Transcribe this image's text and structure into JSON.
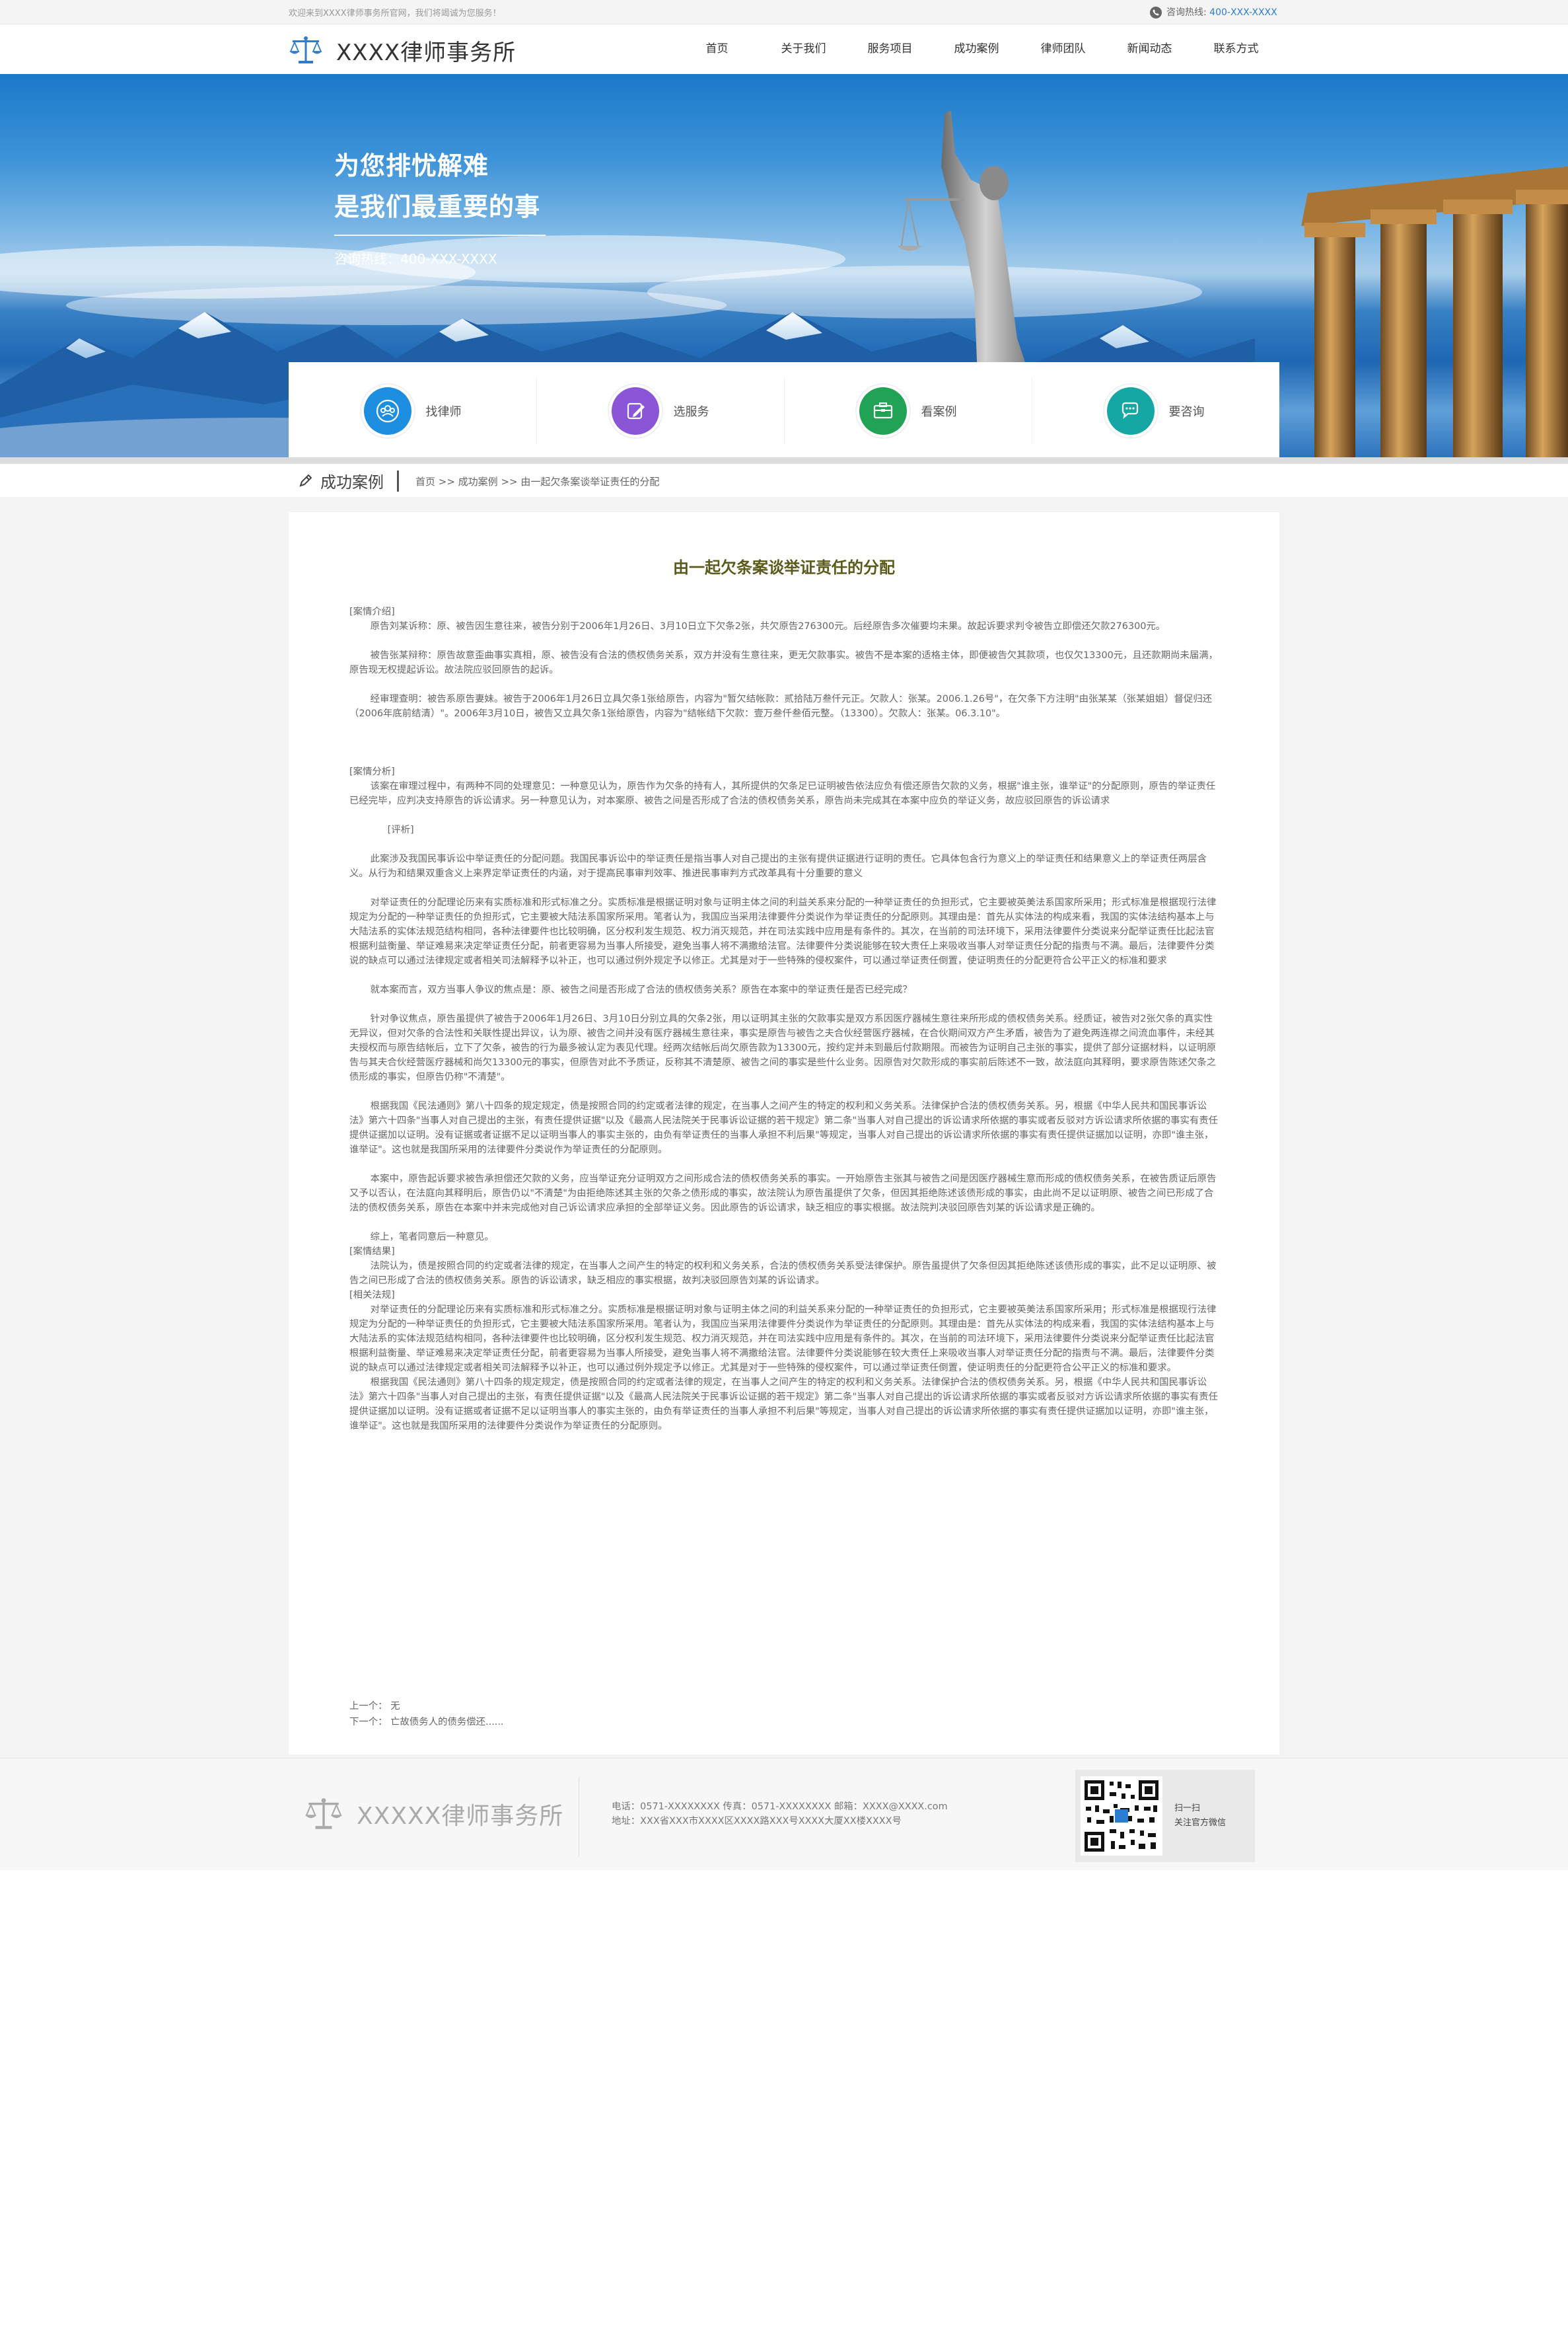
{
  "topbar": {
    "welcome": "欢迎来到XXXX律师事务所官网，我们将竭诚为您服务！",
    "hotline_label": "咨询热线:",
    "hotline_number": "400-XXX-XXXX"
  },
  "header": {
    "logo_text": "XXXX律师事务所",
    "nav": [
      "首页",
      "关于我们",
      "服务项目",
      "成功案例",
      "律师团队",
      "新闻动态",
      "联系方式"
    ]
  },
  "banner": {
    "slogan_line1": "为您排忧解难",
    "slogan_line2": "是我们最重要的事",
    "hotline": "咨询热线：400-XXX-XXXX"
  },
  "services": [
    {
      "label": "找律师",
      "icon": "people-icon",
      "color": "#1e8fe0"
    },
    {
      "label": "选服务",
      "icon": "edit-icon",
      "color": "#8a55d7"
    },
    {
      "label": "看案例",
      "icon": "case-icon",
      "color": "#21a356"
    },
    {
      "label": "要咨询",
      "icon": "chat-icon",
      "color": "#14a7a3"
    }
  ],
  "breadcrumb": {
    "section_title": "成功案例",
    "path": "首页 >> 成功案例 >> 由一起欠条案谈举证责任的分配"
  },
  "article": {
    "title": "由一起欠条案谈举证责任的分配",
    "paragraphs": {
      "p01": "[案情介绍]",
      "p02": "原告刘某诉称：原、被告因生意往来，被告分别于2006年1月26日、3月10日立下欠条2张，共欠原告276300元。后经原告多次催要均未果。故起诉要求判令被告立即偿还欠款276300元。",
      "p03": "被告张某辩称：原告故意歪曲事实真相，原、被告没有合法的债权债务关系，双方并没有生意往来，更无欠款事实。被告不是本案的适格主体，即便被告欠其款项，也仅欠13300元，且还款期尚未届满，原告现无权提起诉讼。故法院应驳回原告的起诉。",
      "p04": "经审理查明：被告系原告妻妹。被告于2006年1月26日立具欠条1张给原告，内容为\"暂欠结帐款：贰拾陆万叁仟元正。欠款人：张某。2006.1.26号\"，在欠条下方注明\"由张某某（张某姐姐）督促归还（2006年底前结清）\"。2006年3月10日，被告又立具欠条1张给原告，内容为\"结帐结下欠款：壹万叁仟叁佰元整。（13300）。欠款人：张某。06.3.10\"。",
      "p05": "[案情分析]",
      "p06": "该案在审理过程中，有两种不同的处理意见：一种意见认为，原告作为欠条的持有人，其所提供的欠条足已证明被告依法应负有偿还原告欠款的义务，根据\"谁主张，谁举证\"的分配原则，原告的举证责任已经完毕，应判决支持原告的诉讼请求。另一种意见认为，对本案原、被告之间是否形成了合法的债权债务关系，原告尚未完成其在本案中应负的举证义务，故应驳回原告的诉讼请求",
      "p07": "[评析]",
      "p08": "此案涉及我国民事诉讼中举证责任的分配问题。我国民事诉讼中的举证责任是指当事人对自己提出的主张有提供证据进行证明的责任。它具体包含行为意义上的举证责任和结果意义上的举证责任两层含义。从行为和结果双重含义上来界定举证责任的内涵，对于提高民事审判效率、推进民事审判方式改革具有十分重要的意义",
      "p09": "对举证责任的分配理论历来有实质标准和形式标准之分。实质标准是根据证明对象与证明主体之间的利益关系来分配的一种举证责任的负担形式，它主要被英美法系国家所采用；形式标准是根据现行法律规定为分配的一种举证责任的负担形式，它主要被大陆法系国家所采用。笔者认为，我国应当采用法律要件分类说作为举证责任的分配原则。其理由是：首先从实体法的构成来看，我国的实体法结构基本上与大陆法系的实体法规范结构相同，各种法律要件也比较明确，区分权利发生规范、权力消灭规范，并在司法实践中应用是有条件的。其次，在当前的司法环境下，采用法律要件分类说来分配举证责任比起法官根据利益衡量、举证难易来决定举证责任分配，前者更容易为当事人所接受，避免当事人将不满撒给法官。法律要件分类说能够在较大责任上来吸收当事人对举证责任分配的指责与不满。最后，法律要件分类说的缺点可以通过法律规定或者相关司法解释予以补正，也可以通过例外规定予以修正。尤其是对于一些特殊的侵权案件，可以通过举证责任倒置，使证明责任的分配更符合公平正义的标准和要求",
      "p10": "就本案而言，双方当事人争议的焦点是：原、被告之间是否形成了合法的债权债务关系？原告在本案中的举证责任是否已经完成？",
      "p11": "针对争议焦点，原告虽提供了被告于2006年1月26日、3月10日分别立具的欠条2张，用以证明其主张的欠款事实是双方系因医疗器械生意往来所形成的债权债务关系。经质证，被告对2张欠条的真实性无异议，但对欠条的合法性和关联性提出异议，认为原、被告之间并没有医疗器械生意往来，事实是原告与被告之夫合伙经营医疗器械，在合伙期间双方产生矛盾，被告为了避免两连襟之间流血事件，未经其夫授权而与原告结帐后，立下了欠条，被告的行为最多被认定为表见代理。经两次结帐后尚欠原告款为13300元，按约定并未到最后付款期限。而被告为证明自己主张的事实，提供了部分证据材料，以证明原告与其夫合伙经营医疗器械和尚欠13300元的事实，但原告对此不予质证，反称其不清楚原、被告之间的事实是些什么业务。因原告对欠款形成的事实前后陈述不一致，故法庭向其释明，要求原告陈述欠条之债形成的事实，但原告仍称\"不清楚\"。",
      "p12": "根据我国《民法通则》第八十四条的规定规定，债是按照合同的约定或者法律的规定，在当事人之间产生的特定的权利和义务关系。法律保护合法的债权债务关系。另，根据《中华人民共和国民事诉讼法》第六十四条\"当事人对自己提出的主张，有责任提供证据\"以及《最高人民法院关于民事诉讼证据的若干规定》第二条\"当事人对自己提出的诉讼请求所依据的事实或者反驳对方诉讼请求所依据的事实有责任提供证据加以证明。没有证据或者证据不足以证明当事人的事实主张的，由负有举证责任的当事人承担不利后果\"等规定，当事人对自己提出的诉讼请求所依据的事实有责任提供证据加以证明，亦即\"谁主张，谁举证\"。这也就是我国所采用的法律要件分类说作为举证责任的分配原则。",
      "p13": "本案中，原告起诉要求被告承担偿还欠款的义务，应当举证充分证明双方之间形成合法的债权债务关系的事实。一开始原告主张其与被告之间是因医疗器械生意而形成的债权债务关系，在被告质证后原告又予以否认，在法庭向其释明后，原告仍以\"不清楚\"为由拒绝陈述其主张的欠条之债形成的事实，故法院认为原告虽提供了欠条，但因其拒绝陈述该债形成的事实，由此尚不足以证明原、被告之间已形成了合法的债权债务关系，原告在本案中并未完成他对自己诉讼请求应承担的全部举证义务。因此原告的诉讼请求，缺乏相应的事实根据。故法院判决驳回原告刘某的诉讼请求是正确的。",
      "p14": "综上，笔者同意后一种意见。",
      "p15": "[案情结果]",
      "p16": "法院认为，债是按照合同的约定或者法律的规定，在当事人之间产生的特定的权利和义务关系，合法的债权债务关系受法律保护。原告虽提供了欠条但因其拒绝陈述该债形成的事实，此不足以证明原、被告之间已形成了合法的债权债务关系。原告的诉讼请求，缺乏相应的事实根据，故判决驳回原告刘某的诉讼请求。",
      "p17": "[相关法规]",
      "p18": "对举证责任的分配理论历来有实质标准和形式标准之分。实质标准是根据证明对象与证明主体之间的利益关系来分配的一种举证责任的负担形式，它主要被英美法系国家所采用；形式标准是根据现行法律规定为分配的一种举证责任的负担形式，它主要被大陆法系国家所采用。笔者认为，我国应当采用法律要件分类说作为举证责任的分配原则。其理由是：首先从实体法的构成来看，我国的实体法结构基本上与大陆法系的实体法规范结构相同，各种法律要件也比较明确，区分权利发生规范、权力消灭规范，并在司法实践中应用是有条件的。其次，在当前的司法环境下，采用法律要件分类说来分配举证责任比起法官根据利益衡量、举证难易来决定举证责任分配，前者更容易为当事人所接受，避免当事人将不满撒给法官。法律要件分类说能够在较大责任上来吸收当事人对举证责任分配的指责与不满。最后，法律要件分类说的缺点可以通过法律规定或者相关司法解释予以补正，也可以通过例外规定予以修正。尤其是对于一些特殊的侵权案件，可以通过举证责任倒置，使证明责任的分配更符合公平正义的标准和要求。",
      "p19": "根据我国《民法通则》第八十四条的规定规定，债是按照合同的约定或者法律的规定，在当事人之间产生的特定的权利和义务关系。法律保护合法的债权债务关系。另，根据《中华人民共和国民事诉讼法》第六十四条\"当事人对自己提出的主张，有责任提供证据\"以及《最高人民法院关于民事诉讼证据的若干规定》第二条\"当事人对自己提出的诉讼请求所依据的事实或者反驳对方诉讼请求所依据的事实有责任提供证据加以证明。没有证据或者证据不足以证明当事人的事实主张的，由负有举证责任的当事人承担不利后果\"等规定，当事人对自己提出的诉讼请求所依据的事实有责任提供证据加以证明，亦即\"谁主张，谁举证\"。这也就是我国所采用的法律要件分类说作为举证责任的分配原则。"
    },
    "prev": "上一个：  无",
    "next": "下一个：  亡故债务人的债务偿还......"
  },
  "footer": {
    "logo_text": "XXXXX律师事务所",
    "contact_line": "电话：0571-XXXXXXXX  传真：0571-XXXXXXXX  邮箱：XXXX@XXXX.com",
    "address_line": "地址：XXX省XXX市XXXX区XXXX路XXX号XXXX大厦XX楼XXXX号",
    "qr_line1": "扫一扫",
    "qr_line2": "关注官方微信"
  },
  "colors": {
    "accent": "#2a7dd1",
    "title_olive": "#5a5a1a"
  }
}
